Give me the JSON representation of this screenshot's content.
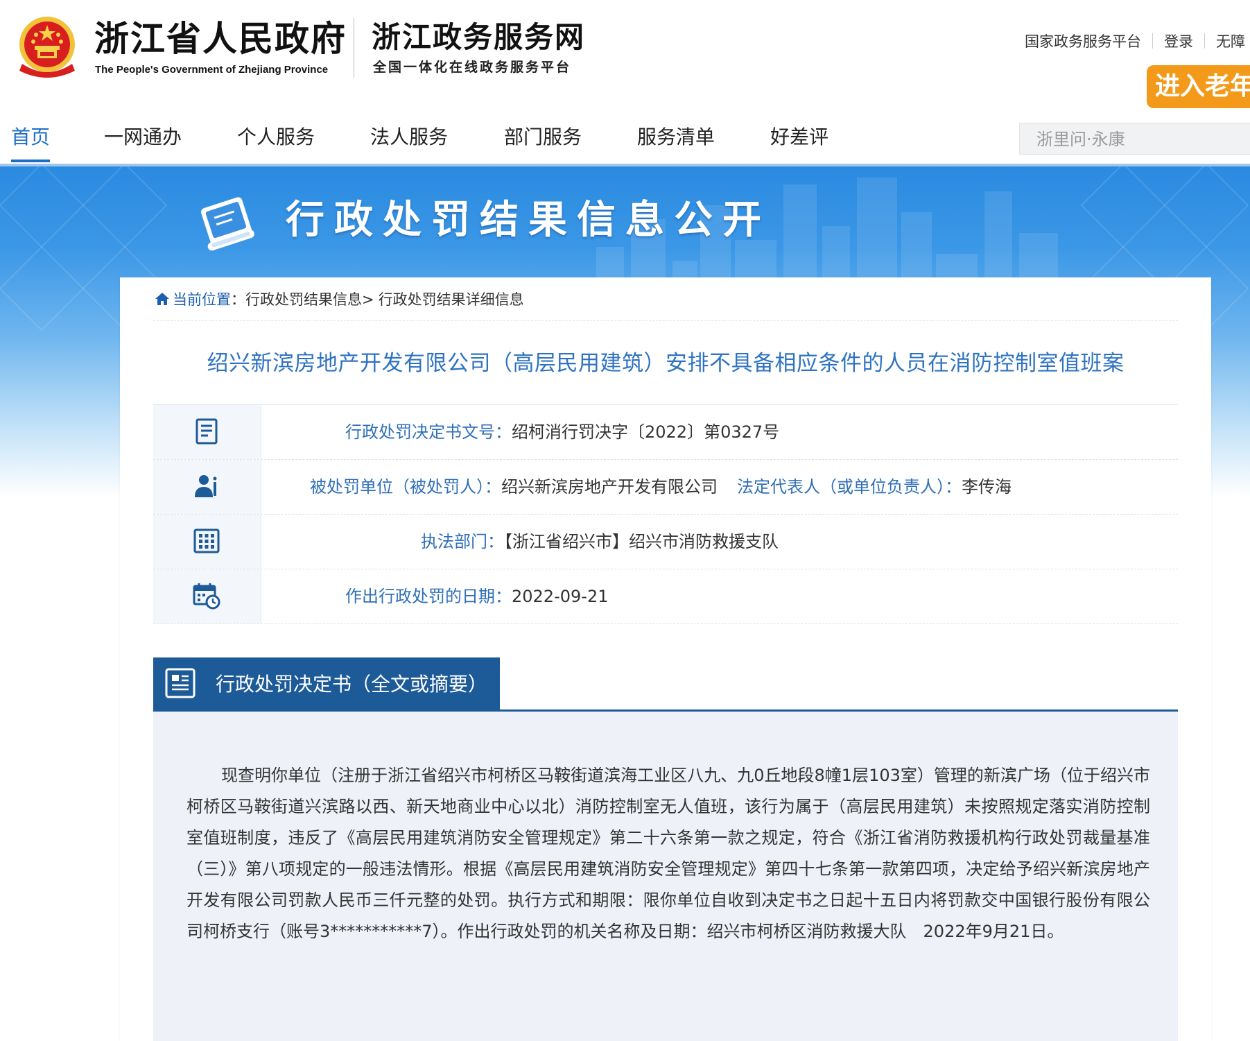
{
  "header": {
    "gov_title": "浙江省人民政府",
    "gov_subtitle": "The People's Government of Zhejiang Province",
    "service_title": "浙江政务服务网",
    "service_subtitle": "全国一体化在线政务服务平台",
    "top_links": [
      "国家政务服务平台",
      "登录",
      "无障"
    ],
    "elder_mode": "进入老年"
  },
  "nav": {
    "items": [
      "首页",
      "一网通办",
      "个人服务",
      "法人服务",
      "部门服务",
      "服务清单",
      "好差评"
    ],
    "active_index": 0,
    "search_placeholder": "浙里问·永康"
  },
  "banner": {
    "title": "行政处罚结果信息公开"
  },
  "breadcrumb": {
    "current_label": "当前位置",
    "sep": "：",
    "items": [
      "行政处罚结果信息>",
      "行政处罚结果详细信息"
    ]
  },
  "case": {
    "title": "绍兴新滨房地产开发有限公司（高层民用建筑）安排不具备相应条件的人员在消防控制室值班案",
    "decision_no_label": "行政处罚决定书文号：",
    "decision_no": "绍柯消行罚决字〔2022〕第0327号",
    "party_label": "被处罚单位（被处罚人）：",
    "party": "绍兴新滨房地产开发有限公司",
    "rep_label": "法定代表人（或单位负责人）：",
    "rep": "李传海",
    "dept_label": "执法部门：",
    "dept": "【浙江省绍兴市】绍兴市消防救援支队",
    "date_label": "作出行政处罚的日期：",
    "date": "2022-09-21"
  },
  "section": {
    "title": "行政处罚决定书（全文或摘要）",
    "content": "现查明你单位（注册于浙江省绍兴市柯桥区马鞍街道滨海工业区八九、九0丘地段8幢1层103室）管理的新滨广场（位于绍兴市柯桥区马鞍街道兴滨路以西、新天地商业中心以北）消防控制室无人值班，该行为属于（高层民用建筑）未按照规定落实消防控制室值班制度，违反了《高层民用建筑消防安全管理规定》第二十六条第一款之规定，符合《浙江省消防救援机构行政处罚裁量基准（三）》第八项规定的一般违法情形。根据《高层民用建筑消防安全管理规定》第四十七条第一款第四项，决定给予绍兴新滨房地产开发有限公司罚款人民币三仟元整的处罚。执行方式和期限：限你单位自收到决定书之日起十五日内将罚款交中国银行股份有限公司柯桥支行（账号3***********7）。作出行政处罚的机关名称及日期：绍兴市柯桥区消防救援大队　2022年9月21日。"
  },
  "colors": {
    "accent_blue": "#1c6fc6",
    "section_blue": "#1d5a98",
    "label_blue": "#2f6fb8",
    "elder_orange": "#f39a1b"
  },
  "icons": [
    "national-emblem-icon",
    "book-icon",
    "home-icon",
    "document-icon",
    "person-icon",
    "building-icon",
    "calendar-icon",
    "article-icon"
  ]
}
